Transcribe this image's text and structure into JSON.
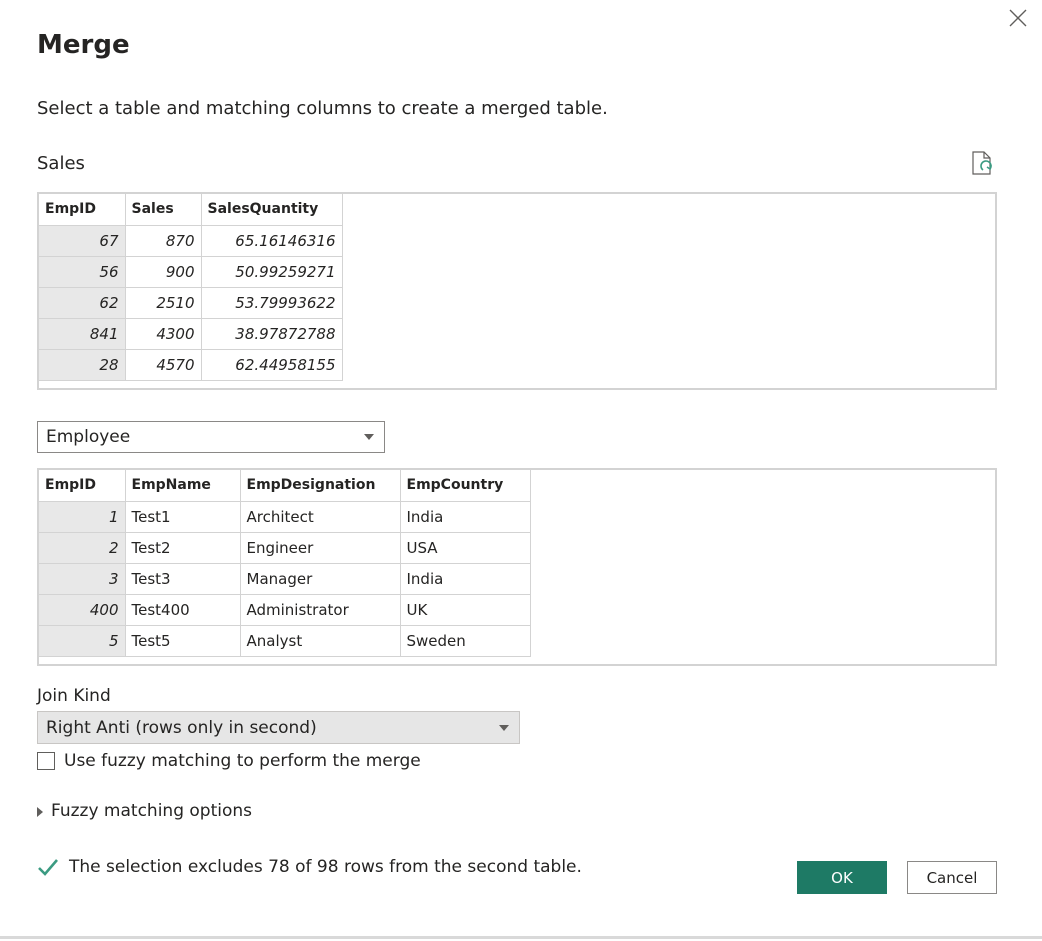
{
  "dialog": {
    "title": "Merge",
    "subtitle": "Select a table and matching columns to create a merged table."
  },
  "first_table": {
    "name": "Sales",
    "columns": [
      "EmpID",
      "Sales",
      "SalesQuantity"
    ],
    "rows": [
      [
        "67",
        "870",
        "65.16146316"
      ],
      [
        "56",
        "900",
        "50.99259271"
      ],
      [
        "62",
        "2510",
        "53.79993622"
      ],
      [
        "841",
        "4300",
        "38.97872788"
      ],
      [
        "28",
        "4570",
        "62.44958155"
      ]
    ]
  },
  "second_table": {
    "selected": "Employee",
    "columns": [
      "EmpID",
      "EmpName",
      "EmpDesignation",
      "EmpCountry"
    ],
    "rows": [
      [
        "1",
        "Test1",
        "Architect",
        "India"
      ],
      [
        "2",
        "Test2",
        "Engineer",
        "USA"
      ],
      [
        "3",
        "Test3",
        "Manager",
        "India"
      ],
      [
        "400",
        "Test400",
        "Administrator",
        "UK"
      ],
      [
        "5",
        "Test5",
        "Analyst",
        "Sweden"
      ]
    ]
  },
  "join": {
    "label": "Join Kind",
    "selected": "Right Anti (rows only in second)"
  },
  "fuzzy": {
    "checkbox_label": "Use fuzzy matching to perform the merge",
    "checked": false,
    "options_label": "Fuzzy matching options"
  },
  "status": {
    "text": "The selection excludes 78 of 98 rows from the second table."
  },
  "buttons": {
    "ok": "OK",
    "cancel": "Cancel"
  },
  "colors": {
    "accent": "#1e7a65",
    "check": "#3b9b82"
  }
}
